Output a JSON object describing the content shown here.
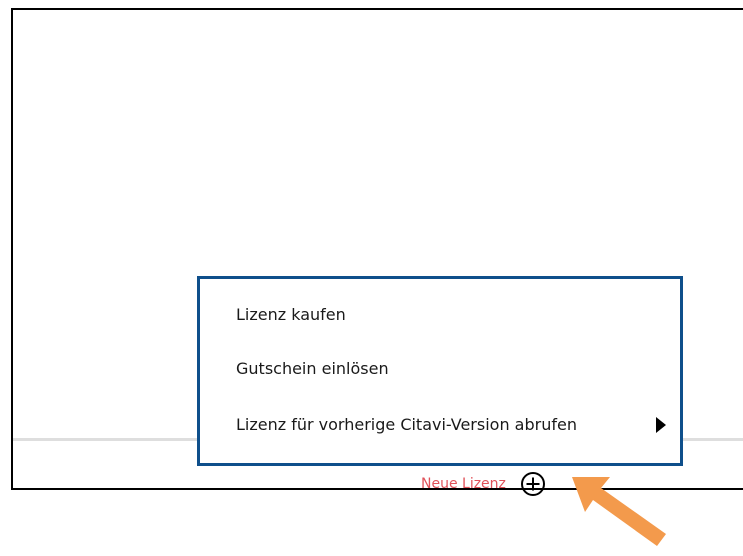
{
  "context_menu": {
    "items": [
      {
        "label": "Lizenz kaufen"
      },
      {
        "label": "Gutschein einlösen"
      },
      {
        "label": "Lizenz für vorherige Citavi-Version abrufen",
        "has_submenu": true
      }
    ],
    "border_color": "#0e4f8b"
  },
  "footer": {
    "new_license_label": "Neue Lizenz",
    "new_license_label_color": "#e0525a",
    "plus_icon": "plus-circle-icon"
  },
  "annotation": {
    "arrow_icon": "pointer-arrow-icon",
    "arrow_color": "#f39a4c"
  }
}
